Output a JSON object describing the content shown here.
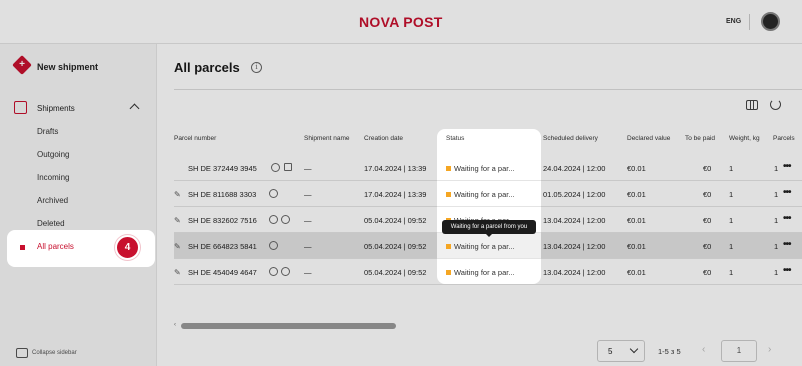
{
  "brand": {
    "logo_text": "NOVA POST",
    "color": "#c8102e"
  },
  "header": {
    "language": "ENG"
  },
  "sidebar": {
    "new_shipment_label": "New shipment",
    "shipments_label": "Shipments",
    "items": [
      {
        "label": "Drafts"
      },
      {
        "label": "Outgoing"
      },
      {
        "label": "Incoming"
      },
      {
        "label": "Archived"
      },
      {
        "label": "Deleted"
      },
      {
        "label": "All parcels",
        "active": true
      }
    ],
    "collapse_label": "Collapse sidebar"
  },
  "main": {
    "title": "All parcels",
    "info_glyph": "i",
    "columns": [
      "Parcel number",
      "Shipment name",
      "Creation date",
      "Status",
      "Scheduled delivery",
      "Declared value",
      "To be paid",
      "Weight, kg",
      "Parcels"
    ],
    "rows": [
      {
        "parcel_number": "SH DE 372449 3945",
        "shipment_name": "—",
        "creation_date": "17.04.2024 | 13:39",
        "status": "Waiting for a par...",
        "scheduled_delivery": "24.04.2024 | 12:00",
        "declared_value": "€0.01",
        "to_be_paid": "€0",
        "weight": "1",
        "parcels": "1"
      },
      {
        "parcel_number": "SH DE 811688 3303",
        "shipment_name": "—",
        "creation_date": "17.04.2024 | 13:39",
        "status": "Waiting for a par...",
        "scheduled_delivery": "01.05.2024 | 12:00",
        "declared_value": "€0.01",
        "to_be_paid": "€0",
        "weight": "1",
        "parcels": "1"
      },
      {
        "parcel_number": "SH DE 832602 7516",
        "shipment_name": "—",
        "creation_date": "05.04.2024 | 09:52",
        "status": "Waiting for a par...",
        "scheduled_delivery": "13.04.2024 | 12:00",
        "declared_value": "€0.01",
        "to_be_paid": "€0",
        "weight": "1",
        "parcels": "1"
      },
      {
        "parcel_number": "SH DE 664823 5841",
        "shipment_name": "—",
        "creation_date": "05.04.2024 | 09:52",
        "status": "Waiting for a par...",
        "scheduled_delivery": "13.04.2024 | 12:00",
        "declared_value": "€0.01",
        "to_be_paid": "€0",
        "weight": "1",
        "parcels": "1"
      },
      {
        "parcel_number": "SH DE 454049 4647",
        "shipment_name": "—",
        "creation_date": "05.04.2024 | 09:52",
        "status": "Waiting for a par...",
        "scheduled_delivery": "13.04.2024 | 12:00",
        "declared_value": "€0.01",
        "to_be_paid": "€0",
        "weight": "1",
        "parcels": "1"
      }
    ],
    "tooltip": "Waiting for a parcel from you",
    "status_color": "#f5a623"
  },
  "pagination": {
    "page_size": "5",
    "range": "1-5 з 5",
    "current_page": "1"
  },
  "tutorial": {
    "step": "4"
  }
}
